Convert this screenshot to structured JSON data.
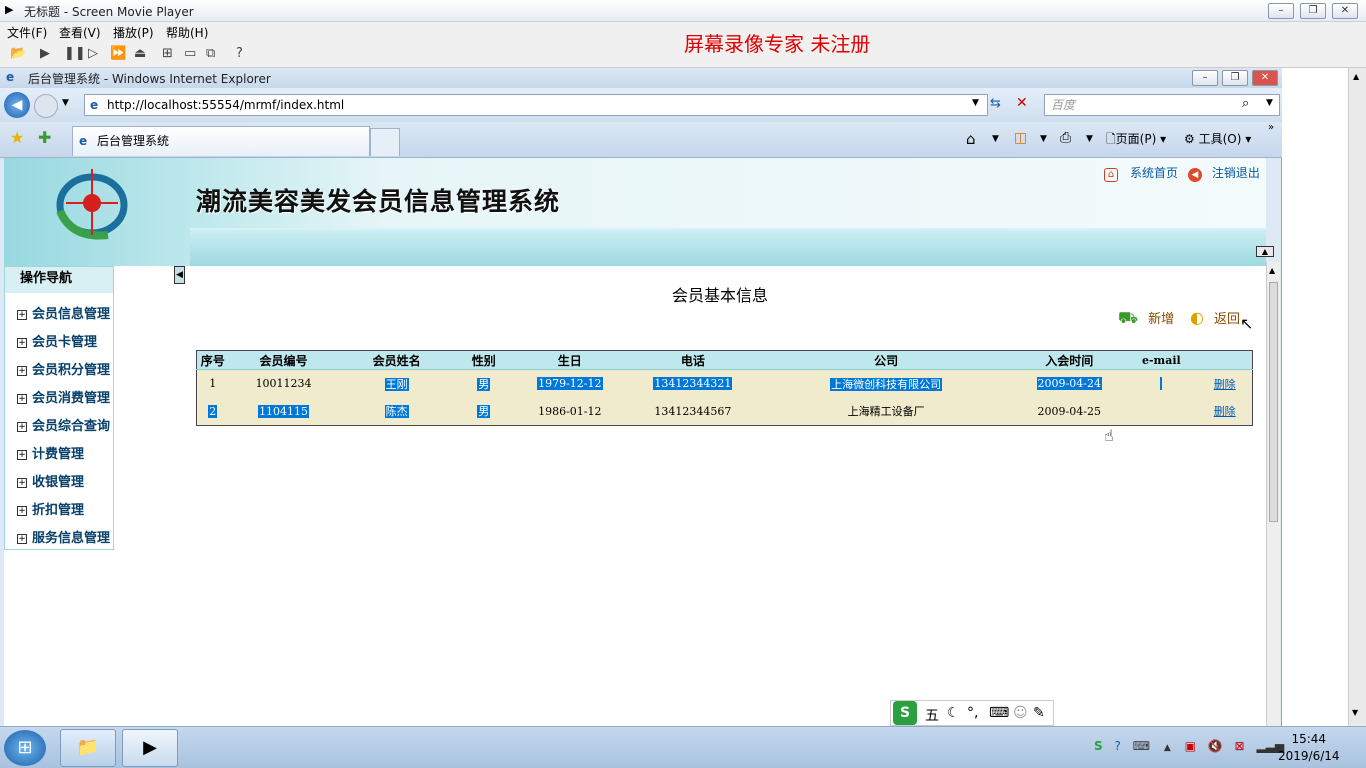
{
  "player": {
    "title": "无标题 - Screen Movie Player",
    "menus": [
      "文件(F)",
      "查看(V)",
      "播放(P)",
      "帮助(H)"
    ],
    "watermark": "屏幕录像专家  未注册"
  },
  "ie": {
    "title": "后台管理系统 - Windows Internet Explorer",
    "url": "http://localhost:55554/mrmf/index.html",
    "search_placeholder": "百度",
    "tab_label": "后台管理系统",
    "page_menu": "页面(P)",
    "tools_menu": "工具(O)"
  },
  "site": {
    "system_title": "潮流美容美发会员信息管理系统",
    "home_link": "系统首页",
    "logout_link": "注销退出",
    "nav_title": "操作导航",
    "nav_items": [
      "会员信息管理",
      "会员卡管理",
      "会员积分管理",
      "会员消费管理",
      "会员综合查询",
      "计费管理",
      "收银管理",
      "折扣管理",
      "服务信息管理"
    ]
  },
  "content": {
    "title": "会员基本信息",
    "add_label": "新增",
    "back_label": "返回",
    "columns": [
      "序号",
      "会员编号",
      "会员姓名",
      "性别",
      "生日",
      "电话",
      "公司",
      "入会时间",
      "e-mail",
      ""
    ],
    "rows": [
      {
        "no": "1",
        "id": "10011234",
        "name": "王刚",
        "gender": "男",
        "birthday": "1979-12-12",
        "phone": "13412344321",
        "company": "上海微创科技有限公司",
        "join_date": "2009-04-24",
        "email": "",
        "action": "删除"
      },
      {
        "no": "2",
        "id": "1104115",
        "name": "陈杰",
        "gender": "男",
        "birthday": "1986-01-12",
        "phone": "13412344567",
        "company": "上海精工设备厂",
        "join_date": "2009-04-25",
        "email": "",
        "action": "删除"
      }
    ]
  },
  "ime": {
    "mode": "五"
  },
  "taskbar": {
    "time": "15:44",
    "date": "2019/6/14"
  },
  "colors": {
    "accent": "#0078d7",
    "watermark": "#e00000",
    "header_row": "#bee8ee",
    "body_row": "#f0ebcc"
  }
}
